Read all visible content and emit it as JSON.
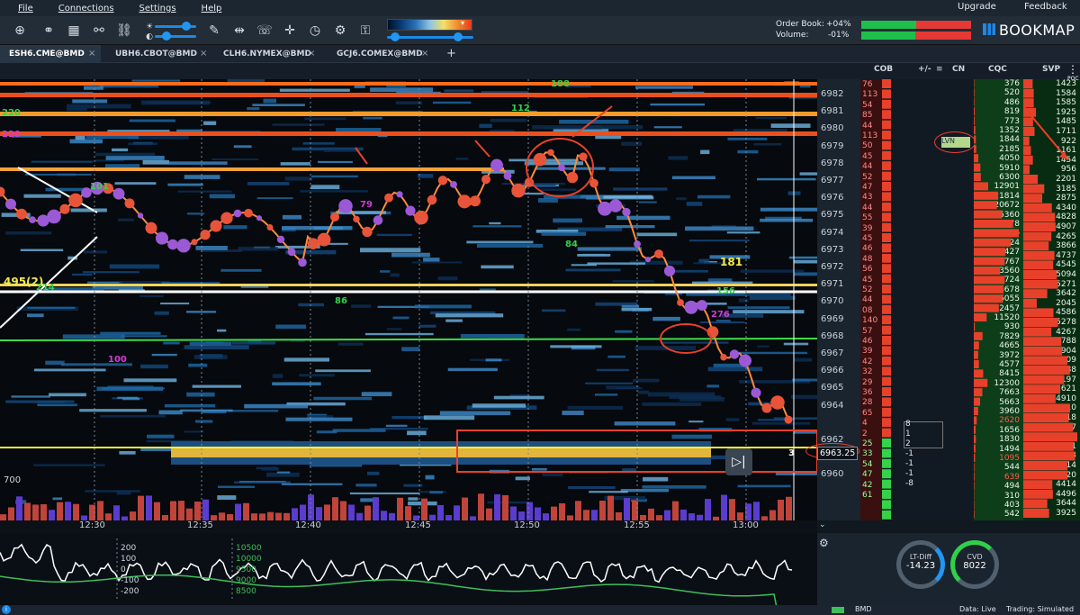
{
  "menu": {
    "items": [
      "File",
      "Connections",
      "Settings",
      "Help"
    ],
    "upgrade": "Upgrade",
    "feedback": "Feedback"
  },
  "toolbar": {
    "order_book_label": "Order Book:",
    "order_book_value": "+04%",
    "volume_label": "Volume:",
    "volume_value": "-01%",
    "brand": "BOOKMAP"
  },
  "tabs": [
    {
      "label": "ESH6.CME@BMD",
      "active": true
    },
    {
      "label": "UBH6.CBOT@BMD",
      "active": false
    },
    {
      "label": "CLH6.NYMEX@BMD",
      "active": false
    },
    {
      "label": "GCJ6.COMEX@BMD",
      "active": false
    }
  ],
  "tab_add": "+",
  "columns": {
    "cob": "COB",
    "delta": "+/-",
    "cn": "CN",
    "cqc": "CQC",
    "svp": "SVP"
  },
  "prices": [
    "6982",
    "6981",
    "6980",
    "6979",
    "6978",
    "6977",
    "6976",
    "6975",
    "6974",
    "6973",
    "6972",
    "6971",
    "6970",
    "6969",
    "6968",
    "6967",
    "6966",
    "6965",
    "6964",
    "6963.25",
    "6962",
    "6961",
    "6960"
  ],
  "cob_values": [
    "76",
    "113",
    "54",
    "85",
    "44",
    "113",
    "50",
    "45",
    "44",
    "52",
    "47",
    "43",
    "44",
    "55",
    "39",
    "45",
    "46",
    "48",
    "56",
    "45",
    "52",
    "44",
    "08",
    "140",
    "57",
    "46",
    "39",
    "42",
    "32",
    "29",
    "36",
    "28",
    "65",
    "4",
    "2",
    "25",
    "33",
    "54",
    "47",
    "42",
    "61"
  ],
  "cqc_values": [
    "376",
    "520",
    "486",
    "819",
    "773",
    "1352",
    "1844",
    "2185",
    "4050",
    "5910",
    "6300",
    "12901",
    "21814",
    "20672",
    "25360",
    "35278",
    "40396",
    "33224",
    "28427",
    "27767",
    "23560",
    "27724",
    "26678",
    "26055",
    "22457",
    "11520",
    "930",
    "7829",
    "4665",
    "3972",
    "4577",
    "8415",
    "12300",
    "7663",
    "5663",
    "3960",
    "2620",
    "1656",
    "1830",
    "1494",
    "1095",
    "544",
    "639",
    "494",
    "310",
    "403",
    "542"
  ],
  "svp_values": [
    "1423",
    "1584",
    "1585",
    "1925",
    "1485",
    "1711",
    "922",
    "1161",
    "1454",
    "956",
    "2201",
    "3185",
    "2875",
    "4340",
    "4828",
    "4907",
    "4265",
    "3866",
    "4737",
    "4545",
    "5094",
    "5271",
    "3642",
    "2045",
    "4586",
    "5278",
    "4267",
    "5788",
    "5904",
    "6709",
    "7088",
    "6197",
    "5621",
    "4910",
    "7110",
    "6918",
    "7557",
    "8210",
    "7651",
    "7863",
    "6714",
    "6720",
    "4414",
    "4496",
    "3644",
    "3925"
  ],
  "delta_values": [
    "8",
    "1",
    "2",
    "-1",
    "-1",
    "-1",
    "-8"
  ],
  "cn_label": "LVN",
  "price_badge": "6963.25",
  "price_badge_qty": "3",
  "times": [
    "12:30",
    "12:35",
    "12:40",
    "12:45",
    "12:50",
    "12:55",
    "13:00"
  ],
  "heatmap_labels": [
    {
      "text": "220",
      "color": "#35d24a"
    },
    {
      "text": "220",
      "color": "#d13bd8"
    },
    {
      "text": "101",
      "color": "#35d24a"
    },
    {
      "text": "112",
      "color": "#35d24a"
    },
    {
      "text": "188",
      "color": "#35d24a"
    },
    {
      "text": "79",
      "color": "#d13bd8"
    },
    {
      "text": "84",
      "color": "#35d24a"
    },
    {
      "text": "181",
      "color": "#f4e84a"
    },
    {
      "text": "495(2)",
      "color": "#f4e84a"
    },
    {
      "text": "214",
      "color": "#35d24a"
    },
    {
      "text": "86",
      "color": "#35d24a"
    },
    {
      "text": "156",
      "color": "#35d24a"
    },
    {
      "text": "276",
      "color": "#d13bd8"
    },
    {
      "text": "100",
      "color": "#d13bd8"
    },
    {
      "text": "700",
      "color": "#cfd6de"
    }
  ],
  "indicator": {
    "left_ticks": [
      "200",
      "100",
      "0",
      "-100",
      "-200"
    ],
    "right_ticks": [
      "10500",
      "10000",
      "9500",
      "9000",
      "8500"
    ]
  },
  "gauges": [
    {
      "label": "LT-Diff",
      "value": "-14.23"
    },
    {
      "label": "CVD",
      "value": "8022"
    }
  ],
  "status": {
    "left_chip": "BMD",
    "data": "Data: Live",
    "trading": "Trading: Simulated"
  },
  "colors": {
    "accent": "#1e88e5",
    "buy": "#35d24a",
    "sell": "#e8412b",
    "annotation": "#e8412b"
  }
}
